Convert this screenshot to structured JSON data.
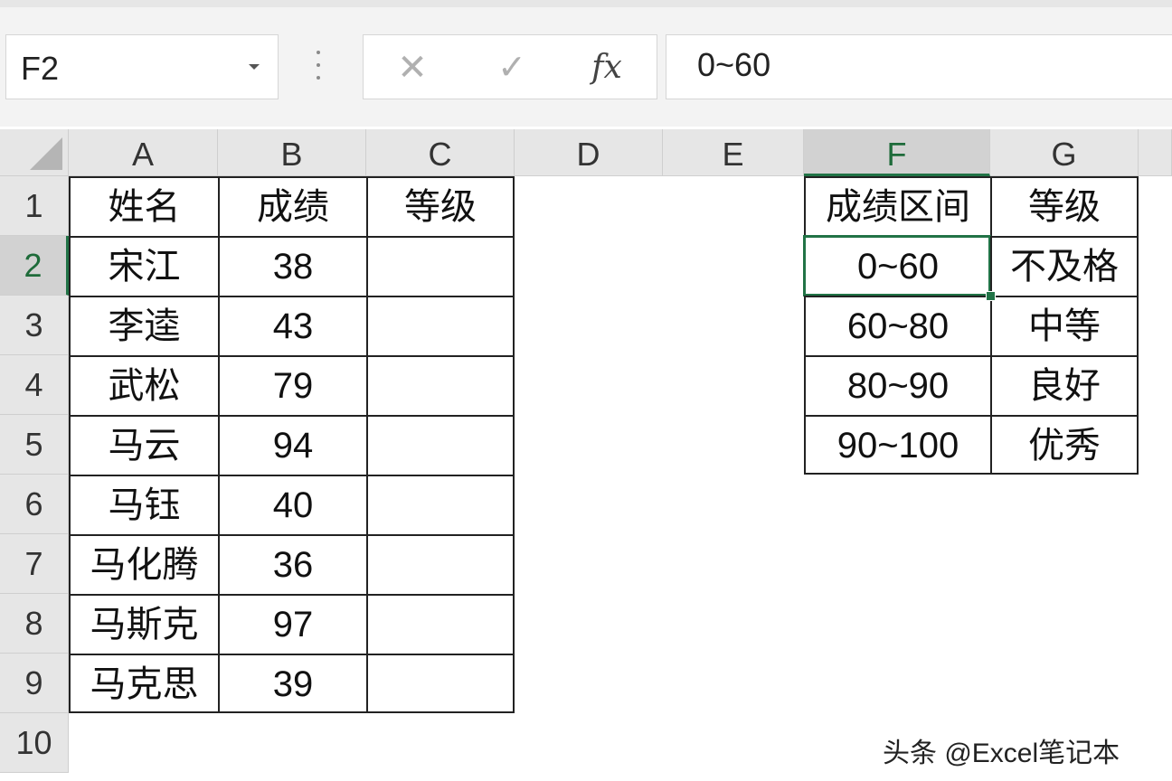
{
  "name_box": {
    "value": "F2"
  },
  "formula_bar": {
    "cancel_label": "✕",
    "enter_label": "✓",
    "fx_label": "fx",
    "value": "0~60"
  },
  "columns": [
    "A",
    "B",
    "C",
    "D",
    "E",
    "F",
    "G"
  ],
  "rows": [
    "1",
    "2",
    "3",
    "4",
    "5",
    "6",
    "7",
    "8",
    "9",
    "10"
  ],
  "table1": {
    "headers": [
      "姓名",
      "成绩",
      "等级"
    ],
    "rows": [
      [
        "宋江",
        "38",
        ""
      ],
      [
        "李逵",
        "43",
        ""
      ],
      [
        "武松",
        "79",
        ""
      ],
      [
        "马云",
        "94",
        ""
      ],
      [
        "马钰",
        "40",
        ""
      ],
      [
        "马化腾",
        "36",
        ""
      ],
      [
        "马斯克",
        "97",
        ""
      ],
      [
        "马克思",
        "39",
        ""
      ]
    ]
  },
  "table2": {
    "headers": [
      "成绩区间",
      "等级"
    ],
    "rows": [
      [
        "0~60",
        "不及格"
      ],
      [
        "60~80",
        "中等"
      ],
      [
        "80~90",
        "良好"
      ],
      [
        "90~100",
        "优秀"
      ]
    ]
  },
  "selection": {
    "active_cell": "F2"
  },
  "watermark": "头条 @Excel笔记本"
}
